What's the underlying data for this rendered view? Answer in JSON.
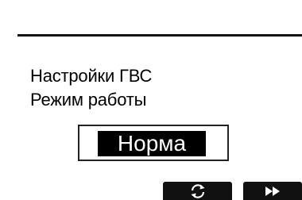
{
  "menu": {
    "section_title": "Настройки ГВС",
    "parameter_label": "Режим работы"
  },
  "selector": {
    "current_value": "Норма"
  },
  "softkeys": [
    {
      "icon": "refresh-icon"
    },
    {
      "icon": "fast-forward-icon"
    }
  ],
  "colors": {
    "background": "#ffffff",
    "foreground": "#000000"
  }
}
